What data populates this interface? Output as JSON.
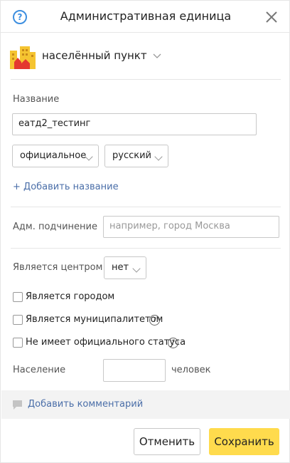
{
  "header": {
    "title": "Административная единица"
  },
  "type_selector": {
    "value": "населённый пункт"
  },
  "name_section": {
    "label": "Название",
    "value": "еатд2_тестинг",
    "kind_select": "официальное",
    "language_select": "русский",
    "add_name_prefix": "+",
    "add_name_label": "Добавить название"
  },
  "subordination": {
    "label": "Адм. подчинение",
    "placeholder": "например, город Москва"
  },
  "center": {
    "label": "Является центром",
    "value": "нет"
  },
  "checkboxes": [
    {
      "label": "Является городом",
      "checked": false,
      "has_help": false
    },
    {
      "label": "Является муниципалитетом",
      "checked": false,
      "has_help": true
    },
    {
      "label": "Не имеет официального статуса",
      "checked": false,
      "has_help": true
    }
  ],
  "population": {
    "label": "Население",
    "value": "",
    "unit": "человек"
  },
  "comment": {
    "label": "Добавить комментарий"
  },
  "footer": {
    "cancel_label": "Отменить",
    "save_label": "Сохранить"
  },
  "colors": {
    "accent_link": "#4a6ea8",
    "help_icon": "#3d8fe0",
    "save_button": "#ffdb4d"
  }
}
